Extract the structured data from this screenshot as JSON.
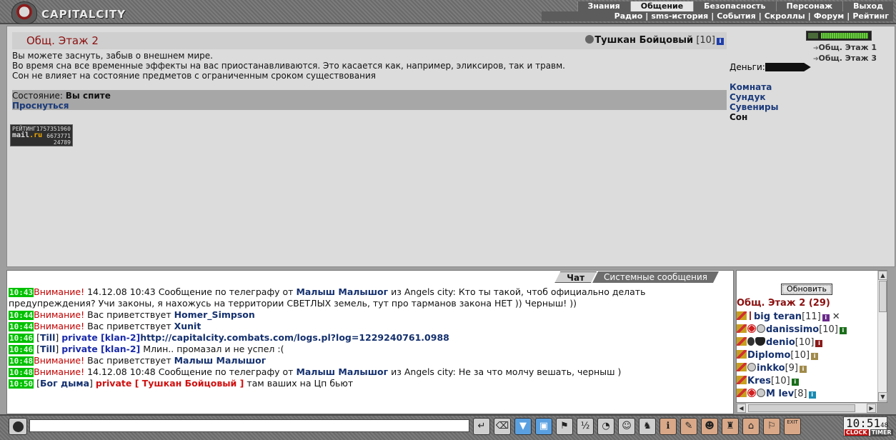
{
  "top": {
    "logo_text": "CAPITALCITY",
    "menu": [
      "Знания",
      "Общение",
      "Безопасность",
      "Персонаж",
      "Выход"
    ],
    "menu_active": "Общение",
    "submenu": [
      "Радио",
      "sms-история",
      "События",
      "Скроллы",
      "Форум",
      "Рейтинг"
    ]
  },
  "room": {
    "title": "Общ. Этаж 2",
    "character_name": "Тушкан Бойцовый",
    "character_level": "[10]",
    "description": [
      "Вы можете заснуть, забыв о внешнем мире.",
      "Во время сна все временные эффекты на вас приостанавливаются. Это касается как, например, эликсиров, так и травм.",
      "Сон не влияет на состояние предметов с ограниченным сроком существования"
    ],
    "status_label": "Состояние:",
    "status_value": "Вы спите",
    "wake_link": "Проснуться",
    "rating": {
      "line1": "РЕЙТИНГ",
      "num1": "1757351960",
      "num2": "6673771",
      "num3": "24789",
      "mail": "mail",
      "ru": ".ru"
    },
    "hp_fraction": 0.97,
    "exits": [
      "Общ. Этаж 1",
      "Общ. Этаж 3"
    ],
    "money_label": "Деньги:",
    "links": [
      "Комната",
      "Сундук",
      "Сувениры",
      "Сон"
    ]
  },
  "chat": {
    "tab_active": "Чат",
    "tab_inactive": "Системные сообщения",
    "messages": [
      {
        "time": "10:43",
        "parts": [
          {
            "c": "warn",
            "t": "Внимание!"
          },
          {
            "c": "plain",
            "t": " 14.12.08 10:43 Сообщение по телеграфу от "
          },
          {
            "c": "nick",
            "t": "Малыш Малышог"
          },
          {
            "c": "plain",
            "t": " из Angels city: Кто ты такой, чтоб официально делать предупреждения? Учи законы, я нахожусь на территории СВЕТЛЫХ земель, тут про тарманов закона НЕТ )) Черныш! ))"
          }
        ]
      },
      {
        "time": "10:44",
        "parts": [
          {
            "c": "warn",
            "t": "Внимание!"
          },
          {
            "c": "plain",
            "t": " Вас приветствует "
          },
          {
            "c": "nick",
            "t": "Homer_Simpson"
          }
        ]
      },
      {
        "time": "10:44",
        "parts": [
          {
            "c": "warn",
            "t": "Внимание!"
          },
          {
            "c": "plain",
            "t": " Вас приветствует "
          },
          {
            "c": "nick",
            "t": "Xunit"
          }
        ]
      },
      {
        "time": "10:46",
        "parts": [
          {
            "c": "plain",
            "t": " ["
          },
          {
            "c": "clan",
            "t": "Till"
          },
          {
            "c": "plain",
            "t": "] "
          },
          {
            "c": "priv",
            "t": "private [klan-2]"
          },
          {
            "c": "url",
            "t": "http://capitalcity.combats.com/logs.pl?log=1229240761.0988"
          }
        ]
      },
      {
        "time": "10:46",
        "parts": [
          {
            "c": "plain",
            "t": " ["
          },
          {
            "c": "clan",
            "t": "Till"
          },
          {
            "c": "plain",
            "t": "] "
          },
          {
            "c": "priv",
            "t": "private [klan-2]"
          },
          {
            "c": "plain",
            "t": " Млин.. промазал и не успел :("
          }
        ]
      },
      {
        "time": "10:48",
        "parts": [
          {
            "c": "warn",
            "t": "Внимание!"
          },
          {
            "c": "plain",
            "t": " Вас приветствует "
          },
          {
            "c": "nick",
            "t": "Малыш Малышог"
          }
        ]
      },
      {
        "time": "10:48",
        "parts": [
          {
            "c": "warn",
            "t": "Внимание!"
          },
          {
            "c": "plain",
            "t": " 14.12.08 10:48 Сообщение по телеграфу от "
          },
          {
            "c": "nick",
            "t": "Малыш Малышог"
          },
          {
            "c": "plain",
            "t": " из Angels city: Не за что молчу вешать, черныш )"
          }
        ]
      },
      {
        "time": "10:50",
        "parts": [
          {
            "c": "plain",
            "t": " ["
          },
          {
            "c": "clan",
            "t": "Бог дыма"
          },
          {
            "c": "plain",
            "t": "] "
          },
          {
            "c": "priv-red",
            "t": "private [ Тушкан Бойцовый ]"
          },
          {
            "c": "plain",
            "t": " там ваших на Цп бьют"
          }
        ]
      }
    ]
  },
  "online": {
    "refresh_label": "Обновить",
    "room_title": "Общ. Этаж 2 (29)",
    "players": [
      {
        "name": "big teran",
        "level": "[11]",
        "icons": [
          "chat",
          "cross"
        ],
        "info": "purple",
        "x": true
      },
      {
        "name": "danissimo",
        "level": "[10]",
        "icons": [
          "chat",
          "clan1",
          "ghost"
        ],
        "info": "green",
        "x": false
      },
      {
        "name": "denio",
        "level": "[10]",
        "icons": [
          "chat",
          "align",
          "shield"
        ],
        "info": "red",
        "x": false
      },
      {
        "name": "Diplomo",
        "level": "[10]",
        "icons": [
          "chat"
        ],
        "info": "tan",
        "x": false
      },
      {
        "name": "inkko",
        "level": "[9]",
        "icons": [
          "chat",
          "ghost"
        ],
        "info": "tan",
        "x": false
      },
      {
        "name": "Kres",
        "level": "[10]",
        "icons": [
          "chat"
        ],
        "info": "green",
        "x": false
      },
      {
        "name": "M lev",
        "level": "[8]",
        "icons": [
          "chat",
          "clan1",
          "ghost"
        ],
        "info": "cyan",
        "x": false
      }
    ]
  },
  "bottom": {
    "input_value": "",
    "clock_time": "10:51",
    "clock_seconds": "48",
    "clock_label_a": "CLOCK",
    "clock_label_b": "TIMER",
    "exit_label": "EXIT"
  }
}
